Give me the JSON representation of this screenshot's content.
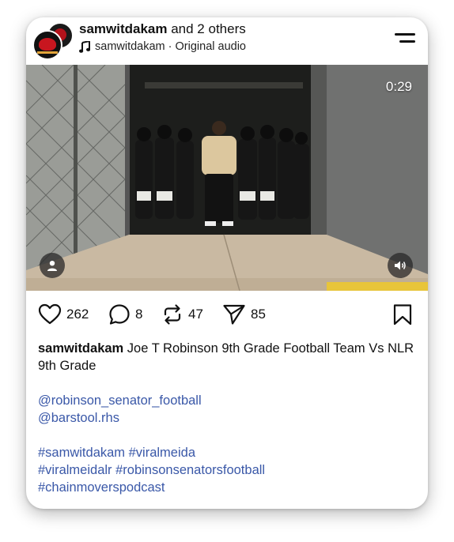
{
  "header": {
    "username": "samwitdakam",
    "others": " and 2 others",
    "audio_user": "samwitdakam",
    "audio_label": " · Original audio",
    "menu_icon": "hamburger-menu-icon"
  },
  "video": {
    "duration": "0:29",
    "user_icon": "person-icon",
    "sound_icon": "speaker-icon"
  },
  "actions": {
    "likes": "262",
    "comments": "8",
    "reposts": "47",
    "shares": "85"
  },
  "caption": {
    "username": "samwitdakam",
    "text": " Joe T Robinson 9th Grade Football Team Vs NLR 9th Grade",
    "mentions": [
      "@robinson_senator_football",
      "@barstool.rhs"
    ],
    "hashtag_lines": [
      "#samwitdakam #viralmeida",
      "#viralmeidalr #robinsonsenatorsfootball",
      "#chainmoverspodcast"
    ]
  },
  "colors": {
    "link": "#3a58a8",
    "text": "#111111"
  }
}
